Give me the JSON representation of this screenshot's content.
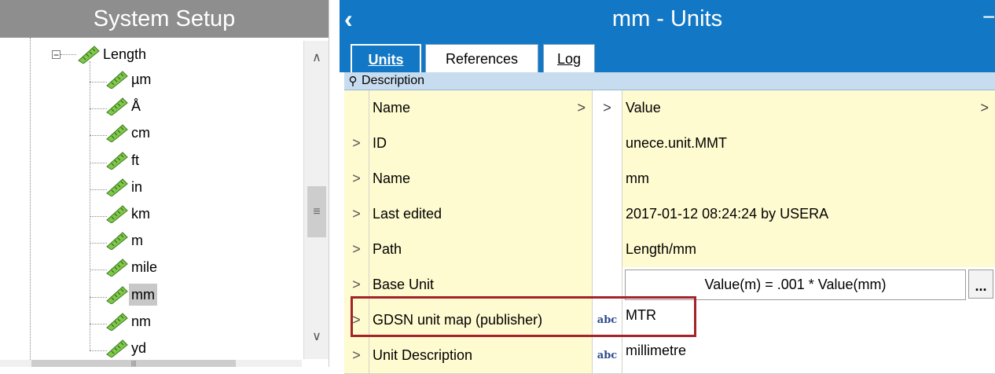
{
  "left_panel": {
    "title": "System Setup",
    "tree": {
      "parent": {
        "label": "Length",
        "expander": "−"
      },
      "children": [
        {
          "label": "µm"
        },
        {
          "label": "Å"
        },
        {
          "label": "cm"
        },
        {
          "label": "ft"
        },
        {
          "label": "in"
        },
        {
          "label": "km"
        },
        {
          "label": "m"
        },
        {
          "label": "mile"
        },
        {
          "label": "mm",
          "selected": true
        },
        {
          "label": "nm"
        },
        {
          "label": "yd"
        }
      ]
    },
    "scrollbar": {
      "up": "∧",
      "grip": "≡",
      "down": "∨"
    },
    "hscroll_grip": "|||"
  },
  "right_panel": {
    "title": "mm - Units",
    "back_icon": "‹",
    "extra": "−",
    "tabs": [
      {
        "label": "Units",
        "active": true
      },
      {
        "label": "References",
        "active": false
      },
      {
        "label": "Log",
        "active": false
      }
    ],
    "section": {
      "icon": "pin-icon",
      "icon_glyph": "⚲",
      "label": "Description"
    },
    "columns": {
      "name": "Name",
      "value": "Value",
      "chevron": ">"
    },
    "rows": [
      {
        "expander": ">",
        "name": "ID",
        "type": "",
        "value": "unece.unit.MMT"
      },
      {
        "expander": ">",
        "name": "Name",
        "type": "",
        "value": "mm"
      },
      {
        "expander": ">",
        "name": "Last edited",
        "type": "",
        "value": "2017-01-12 08:24:24 by USERA"
      },
      {
        "expander": ">",
        "name": "Path",
        "type": "",
        "value": "Length/mm"
      },
      {
        "expander": ">",
        "name": "Base Unit",
        "type": "",
        "value": "Value(m) = .001 * Value(mm)",
        "button": "..."
      },
      {
        "expander": ">",
        "name": "GDSN unit map (publisher)",
        "type": "abc",
        "value": "MTR"
      },
      {
        "expander": ">",
        "name": "Unit Description",
        "type": "abc",
        "value": "millimetre"
      }
    ]
  },
  "colors": {
    "accent": "#1278c5",
    "left_header": "#8e8e8e",
    "row_yellow": "#fffbd0",
    "highlight_box": "#a32329"
  }
}
